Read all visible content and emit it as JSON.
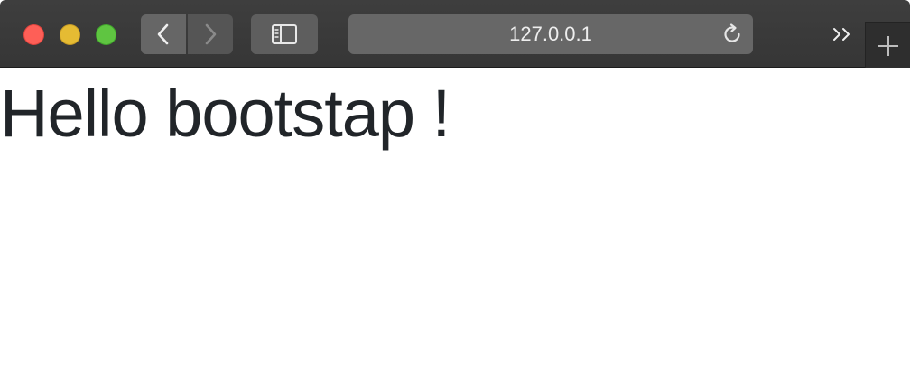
{
  "browser": {
    "address": "127.0.0.1",
    "icons": {
      "close": "close-window",
      "minimize": "minimize-window",
      "maximize": "maximize-window",
      "back": "chevron-left",
      "forward": "chevron-right",
      "sidebar": "sidebar",
      "reload": "reload",
      "overflow": "double-chevron-right",
      "new_tab": "plus"
    },
    "colors": {
      "toolbar": "#3a3a3a",
      "close": "#fe5f57",
      "minimize": "#e5bb33",
      "maximize": "#5fc541"
    }
  },
  "page": {
    "heading": "Hello bootstap !",
    "heading_color": "#212529"
  }
}
